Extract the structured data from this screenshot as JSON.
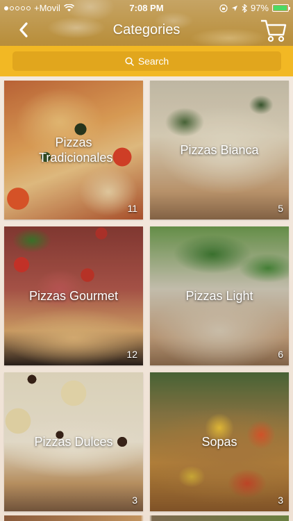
{
  "status_bar": {
    "carrier": "+Movil",
    "time": "7:08 PM",
    "battery": "97%",
    "battery_level": 0.97
  },
  "nav": {
    "title": "Categories",
    "back_icon": "chevron-left-icon",
    "cart_icon": "cart-icon"
  },
  "search": {
    "placeholder": "Search",
    "icon": "search-icon"
  },
  "categories": [
    {
      "name": "Pizzas Tradicionales",
      "count": "11"
    },
    {
      "name": "Pizzas Bianca",
      "count": "5"
    },
    {
      "name": "Pizzas Gourmet",
      "count": "12"
    },
    {
      "name": "Pizzas Light",
      "count": "6"
    },
    {
      "name": "Pizzas Dulces",
      "count": "3"
    },
    {
      "name": "Sopas",
      "count": "3"
    }
  ],
  "colors": {
    "header_gold": "#b98f3c",
    "search_bar": "#f2b824",
    "search_field": "#e1a61d",
    "battery_green": "#4cd964"
  }
}
